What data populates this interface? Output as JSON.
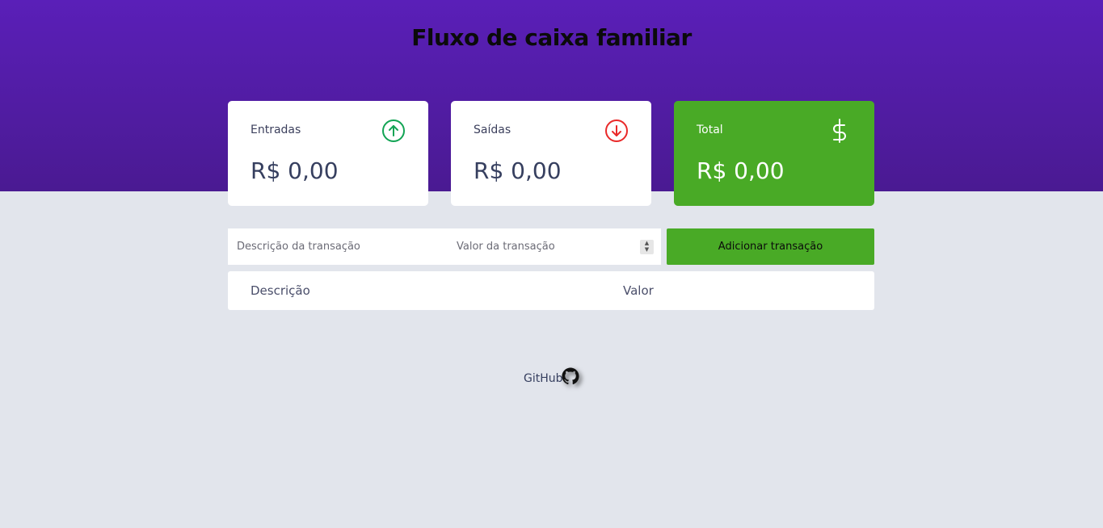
{
  "header": {
    "title": "Fluxo de caixa familiar"
  },
  "summary": {
    "income": {
      "label": "Entradas",
      "amount": "R$ 0,00",
      "icon": "arrow-up-circle-icon",
      "color": "#12a454"
    },
    "expense": {
      "label": "Saídas",
      "amount": "R$ 0,00",
      "icon": "arrow-down-circle-icon",
      "color": "#e92929"
    },
    "total": {
      "label": "Total",
      "amount": "R$ 0,00",
      "icon": "dollar-icon",
      "color": "#49aa26"
    }
  },
  "form": {
    "description_placeholder": "Descrição da transação",
    "amount_placeholder": "Valor da transação",
    "submit_label": "Adicionar transação"
  },
  "table": {
    "columns": [
      "Descrição",
      "Valor"
    ]
  },
  "footer": {
    "link_label": "GitHub",
    "icon": "github-icon"
  },
  "colors": {
    "header_bg": "#5a1fb8",
    "page_bg": "#e2e5ec",
    "accent_green": "#49aa26"
  }
}
